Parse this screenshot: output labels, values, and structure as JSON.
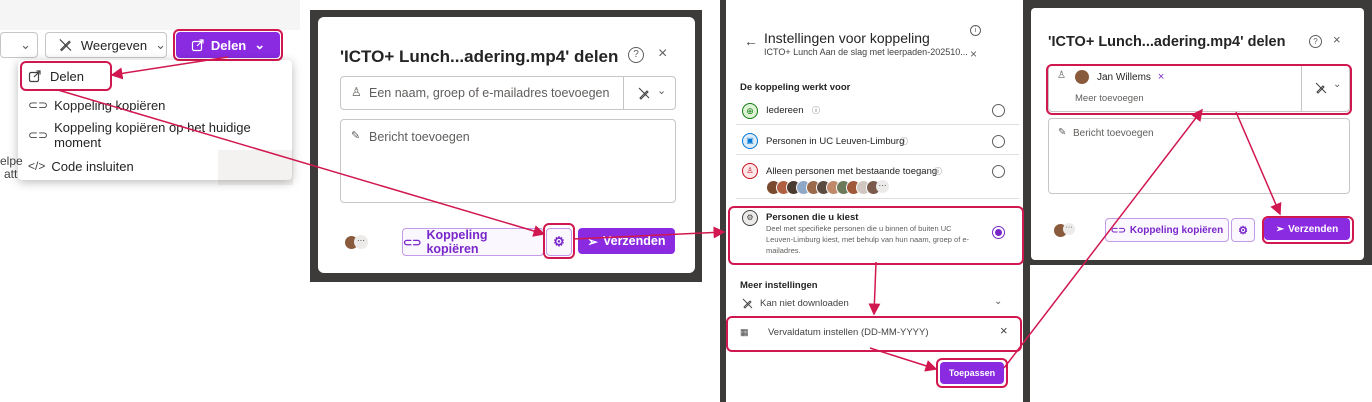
{
  "toolbar": {
    "first_btn_chevron": "⌄",
    "weergeven": "Weergeven",
    "delen": "Delen",
    "left_text_1": "elpe",
    "left_text_2": "att"
  },
  "menu": {
    "items": [
      "Delen",
      "Koppeling kopiëren",
      "Koppeling kopiëren op het huidige moment",
      "Code insluiten"
    ]
  },
  "share_dialog": {
    "title": "'ICTO+ Lunch...adering.mp4' delen",
    "name_placeholder": "Een naam, groep of e-mailadres toevoegen",
    "message_placeholder": "Bericht toevoegen",
    "copy_link": "Koppeling kopiëren",
    "send": "Verzenden",
    "more": "···"
  },
  "settings_dialog": {
    "title": "Instellingen voor koppeling",
    "subtitle": "ICTO+ Lunch Aan de slag met leerpaden-202510...",
    "section_label": "De koppeling werkt voor",
    "options": [
      {
        "label": "Iedereen",
        "selected": false
      },
      {
        "label": "Personen in UC Leuven-Limburg",
        "selected": false
      },
      {
        "label": "Alleen personen met bestaande toegang",
        "selected": false
      },
      {
        "label": "Personen die u kiest",
        "selected": true,
        "description_1": "Deel met specifieke personen die u binnen of buiten UC",
        "description_2": "Leuven-Limburg kiest, met behulp van hun naam, groep of e-",
        "description_3": "mailadres."
      }
    ],
    "more_settings": "Meer instellingen",
    "cannot_download": "Kan niet downloaden",
    "expiry": "Vervaldatum instellen (DD-MM-YYYY)",
    "apply": "Toepassen"
  },
  "share_dialog_2": {
    "title": "'ICTO+ Lunch...adering.mp4' delen",
    "person": "Jan Willems",
    "more_add": "Meer toevoegen",
    "message_placeholder": "Bericht toevoegen",
    "copy_link": "Koppeling kopiëren",
    "send": "Verzenden"
  },
  "colors": {
    "accent": "#8a2be2",
    "highlight": "#d1174f",
    "dark_bg": "#3d3b39"
  }
}
